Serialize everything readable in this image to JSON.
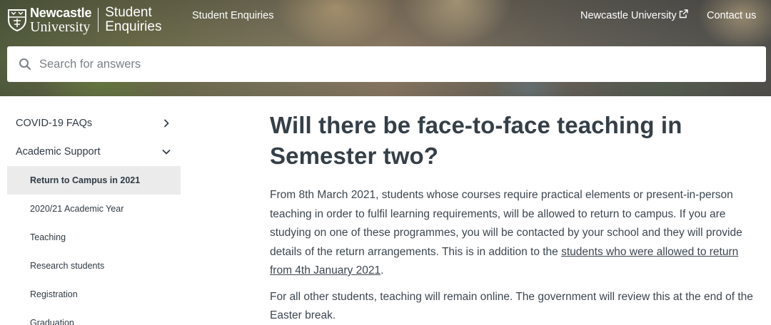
{
  "header": {
    "logo": {
      "line1": "Newcastle",
      "line2": "University",
      "product_line1": "Student",
      "product_line2": "Enquiries"
    },
    "nav": {
      "student_enquiries": "Student Enquiries",
      "newcastle_university": "Newcastle University",
      "contact_us": "Contact us"
    },
    "search": {
      "placeholder": "Search for answers",
      "value": ""
    }
  },
  "sidebar": {
    "sections": [
      {
        "label": "COVID-19 FAQs",
        "expanded": false
      },
      {
        "label": "Academic Support",
        "expanded": true
      }
    ],
    "items": [
      {
        "label": "Return to Campus in 2021",
        "active": true
      },
      {
        "label": "2020/21 Academic Year"
      },
      {
        "label": "Teaching"
      },
      {
        "label": "Research students"
      },
      {
        "label": "Registration"
      },
      {
        "label": "Graduation"
      }
    ]
  },
  "article": {
    "title": "Will there be face-to-face teaching in Semester two?",
    "p1_text": "From 8th March 2021, students whose courses require practical elements or present-in-person teaching in order to fulfil learning requirements, will be allowed to return to campus. If you are studying on one of these programmes, you will be contacted by your school and they will provide details of the return arrangements. This is in addition to the ",
    "p1_link": "students who were allowed to return from 4th January 2021",
    "p1_end": ".",
    "p2_text": "For all other students, teaching will remain online. The government will review this at the end of the Easter break."
  },
  "colors": {
    "text": "#353f48",
    "active_bg": "#ebebeb",
    "header_text": "#ffffff"
  }
}
